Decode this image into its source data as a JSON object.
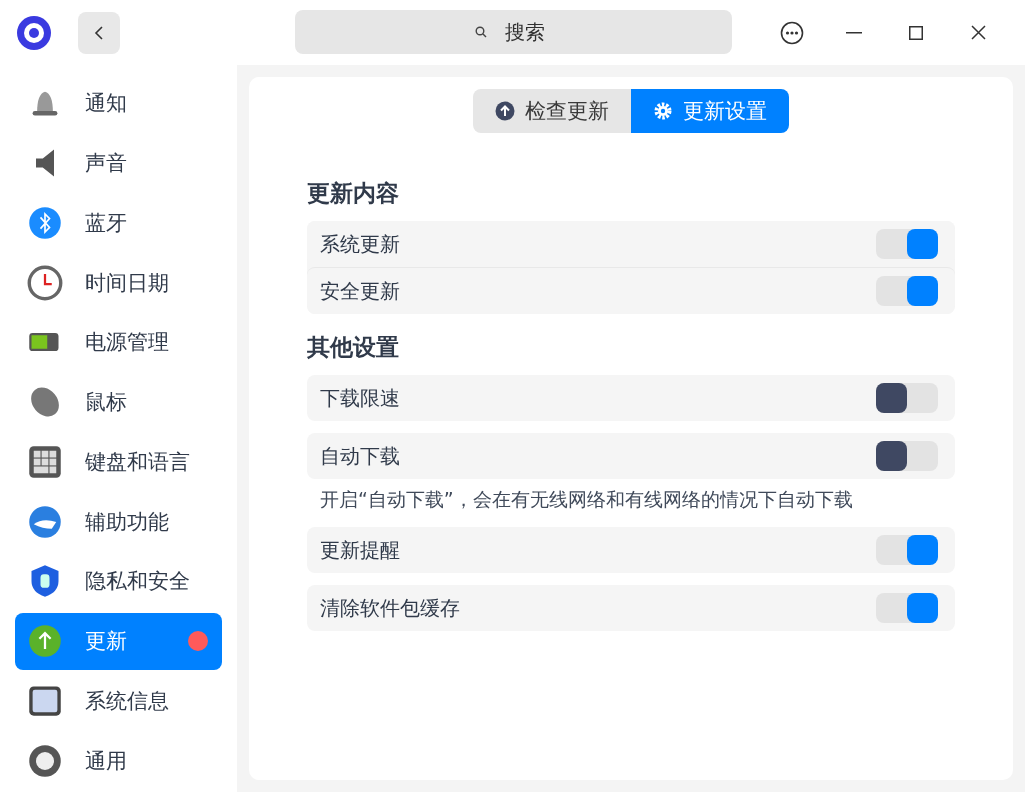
{
  "titlebar": {
    "search": {
      "placeholder": "搜索"
    }
  },
  "sidebar": {
    "items": [
      {
        "label": "通知",
        "selected": false,
        "badge": false
      },
      {
        "label": "声音",
        "selected": false,
        "badge": false
      },
      {
        "label": "蓝牙",
        "selected": false,
        "badge": false
      },
      {
        "label": "时间日期",
        "selected": false,
        "badge": false
      },
      {
        "label": "电源管理",
        "selected": false,
        "badge": false
      },
      {
        "label": "鼠标",
        "selected": false,
        "badge": false
      },
      {
        "label": "键盘和语言",
        "selected": false,
        "badge": false
      },
      {
        "label": "辅助功能",
        "selected": false,
        "badge": false
      },
      {
        "label": "隐私和安全",
        "selected": false,
        "badge": false
      },
      {
        "label": "更新",
        "selected": true,
        "badge": true
      },
      {
        "label": "系统信息",
        "selected": false,
        "badge": false
      },
      {
        "label": "通用",
        "selected": false,
        "badge": false
      }
    ]
  },
  "tabs": [
    {
      "label": "检查更新",
      "selected": false
    },
    {
      "label": "更新设置",
      "selected": true
    }
  ],
  "sections": [
    {
      "title": "更新内容",
      "grouped": true,
      "items": [
        {
          "kind": "toggle",
          "label": "系统更新",
          "on": true
        },
        {
          "kind": "toggle",
          "label": "安全更新",
          "on": true
        }
      ]
    },
    {
      "title": "其他设置",
      "grouped": false,
      "items": [
        {
          "kind": "toggle",
          "label": "下载限速",
          "on": false
        },
        {
          "kind": "toggle",
          "label": "自动下载",
          "on": false
        },
        {
          "kind": "note",
          "text": "开启“自动下载”，会在有无线网络和有线网络的情况下自动下载"
        },
        {
          "kind": "toggle",
          "label": "更新提醒",
          "on": true
        },
        {
          "kind": "toggle",
          "label": "清除软件包缓存",
          "on": true
        }
      ]
    }
  ]
}
